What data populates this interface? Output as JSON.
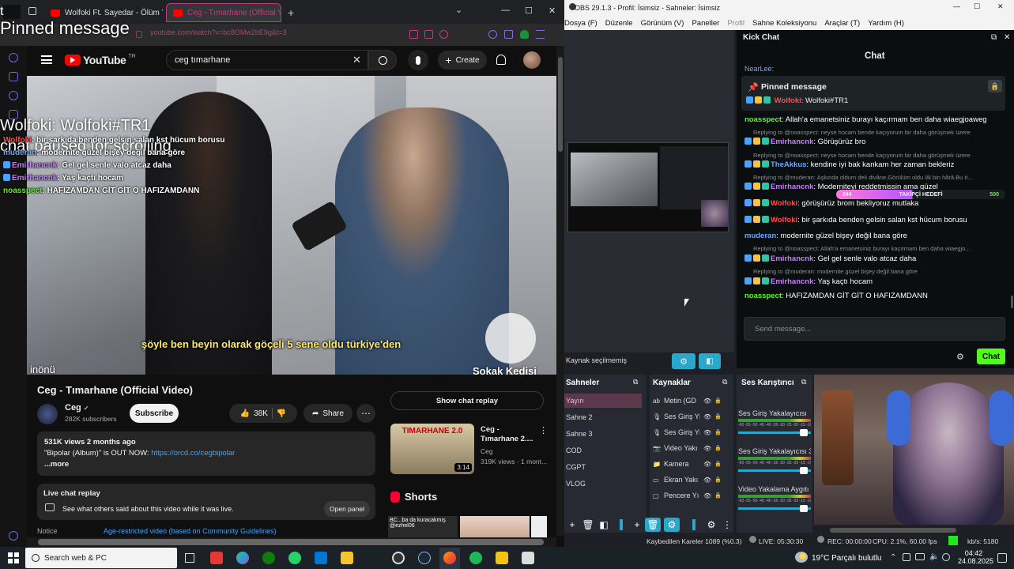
{
  "browser": {
    "tabs": [
      {
        "label": "Wolfoki Ft. Sayedar - Ölüm Yok"
      },
      {
        "label": "Ceg - Tımarhane (Official V"
      }
    ],
    "url": "youtube.com/watch?v=bc8OMw2bE9g&t=3",
    "window_controls": {
      "minimize": "—",
      "maximize": "☐",
      "close": "✕"
    }
  },
  "overlay": {
    "pinned_label": "Pinned message",
    "corner_t": "t",
    "pinned_text": "Wolfoki: Wolfoki#TR1",
    "paused_text": "chat paused for scrolling",
    "messages": [
      {
        "user": "Wolfoki",
        "text": ": bir şarkıda benden gelsin salan kst hücum borusu"
      },
      {
        "user": "muderan",
        "text": ": modernite güzel bişey değil bana göre"
      },
      {
        "user": "Emirhancnk",
        "text": ": Gel gel senle valo atcaz daha"
      },
      {
        "user": "Emirhancnk",
        "text": ": Yaş kaçtı hocam"
      },
      {
        "user": "noasspect",
        "text": ": HAFIZAMDAN GİT GİT O HAFIZAMDANN"
      }
    ]
  },
  "youtube": {
    "logo_text": "YouTube",
    "logo_sup": "TR",
    "search_value": "ceg tımarhane",
    "create_label": "Create",
    "subtitle": "şöyle ben beyin olarak göçeli 5 sene oldu türkiye'den",
    "watermark_top": "Sokak Kedisi",
    "location_text": "inönü",
    "video_title": "Ceg - Tımarhane (Official Video)",
    "channel_name": "Ceg",
    "subscribers": "282K subscribers",
    "subscribe_label": "Subscribe",
    "like_count": "38K",
    "share_label": "Share",
    "views_line": "531K views  2 months ago",
    "desc_line1": "\"Bipolar (Album)\" is OUT NOW: ",
    "desc_link": "https://orcd.co/cegbipolar",
    "more_label": "...more",
    "live_chat_title": "Live chat replay",
    "live_chat_desc": "See what others said about this video while it was live.",
    "open_panel_label": "Open panel",
    "notice_label": "Notice",
    "notice_link": "Age-restricted video (based on Community Guidelines)",
    "show_chat_replay": "Show chat replay",
    "rec_title": "Ceg - Tımarhane 2....",
    "rec_channel": "Ceg",
    "rec_meta": "319K views · 1 mont...",
    "rec_duration": "3:14",
    "rec_thumb_text": "TIMARHANE 2.0",
    "shorts_label": "Shorts",
    "short_thumb_text": "BC...ba da kuracakmış @ezhel06"
  },
  "obs": {
    "title": "OBS 29.1.3 - Profil: İsimsiz - Sahneler: İsimsiz",
    "menu": [
      "Dosya (F)",
      "Düzenle",
      "Görünüm (V)",
      "Paneller",
      "Profil",
      "Sahne Koleksiyonu",
      "Araçlar (T)",
      "Yardım (H)"
    ],
    "no_source": "Kaynak seçilmemiş",
    "scenes_head": "Sahneler",
    "scenes": [
      "Yayın",
      "Sahne 2",
      "Sahne 3",
      "COD",
      "CGPT",
      "VLOG"
    ],
    "sources_head": "Kaynaklar",
    "sources": [
      "Metin (GD",
      "Ses Giriş Yı",
      "Ses Giriş Yı",
      "Video Yakı",
      "Kamera",
      "Ekran Yakı",
      "Pencere Yı"
    ],
    "mixer_head": "Ses Karıştırıcı",
    "mixer_channels": [
      "Ses Giriş Yakalayıcısı",
      "Ses Giriş Yakalayıcısı 3",
      "Video Yakalama Aygıtı"
    ],
    "mixer_scale": "-60 -55 -50 -45 -40 -35 -30 -25 -20 -15 -10 -5 0",
    "status": {
      "dropped": "Kaybedilen Kareler 1089 (%0.3)",
      "live": "LIVE: 05:30:30",
      "rec": "REC: 00:00:00",
      "cpu": "CPU: 2.1%, 60.00 fps",
      "kbps": "kb/s: 5180"
    }
  },
  "kick_chat": {
    "dock_title": "Kick Chat",
    "header": "Chat",
    "pinned_label": "Pinned message",
    "pinned_user": "Wolfoki",
    "pinned_text": ": Wolfoki#TR1",
    "top_user": "NearLee:",
    "goal_text": "TAKİPÇİ HEDEFİ",
    "goal_current": "244",
    "goal_target": "500",
    "messages": [
      {
        "reply": "",
        "user": "noasspect",
        "text": ": Allah'a emanetsiniz burayı kaçırmam ben daha wiaegjoaweg",
        "color": "u-green"
      },
      {
        "reply": "Replying to @noasspect: neyse hocam bende kaçıyorum bir daha görüşmek üzere",
        "user": "Emirhancnk",
        "text": ": Görüşürüz bro",
        "color": "u-purple"
      },
      {
        "reply": "Replying to @noasspect: neyse hocam bende kaçıyorum bir daha görüşmek üzere",
        "user": "TheAkkus",
        "text": ": kendine iyi bak kankam her zaman bekleriz",
        "color": "u-blue"
      },
      {
        "reply": "Replying to @muderan: Aşkında oldum deli divâne,Görülüm oldu lâl bin hârâ.Bu ö...",
        "user": "Emirhancnk",
        "text": ": Moderniteyi reddetmissin ama güzel",
        "color": "u-purple"
      },
      {
        "reply": "",
        "user": "Wolfoki",
        "text": ": görüşürüz brom bekliyoruz mutlaka",
        "color": "u-red"
      },
      {
        "reply": "",
        "user": "Wolfoki",
        "text": ": bir şarkıda benden gelsin salan kst hücum borusu",
        "color": "u-red"
      },
      {
        "reply": "",
        "user": "muderan",
        "text": ": modernite güzel bişey değil bana göre",
        "color": "u-blue"
      },
      {
        "reply": "Replying to @noasspect: Allah'a emanetsiniz burayı kaçırmam ben daha wiaegjo...",
        "user": "Emirhancnk",
        "text": ": Gel gel senle valo atcaz daha",
        "color": "u-purple"
      },
      {
        "reply": "Replying to @muderan: modernite güzel bişey değil bana göre",
        "user": "Emirhancnk",
        "text": ": Yaş kaçtı hocam",
        "color": "u-purple"
      },
      {
        "reply": "",
        "user": "noasspect",
        "text": ": HAFIZAMDAN GİT GİT O HAFIZAMDANN",
        "color": "u-green"
      }
    ],
    "input_placeholder": "Send message...",
    "send_label": "Chat"
  },
  "taskbar": {
    "search_placeholder": "Search web & PC",
    "weather": "19°C  Parçalı bulutlu",
    "time": "04:42",
    "date": "24.08.2025"
  },
  "colors": {
    "kick_green": "#53fc18",
    "youtube_red": "#ff0000",
    "obs_accent": "#2ba7c9"
  }
}
